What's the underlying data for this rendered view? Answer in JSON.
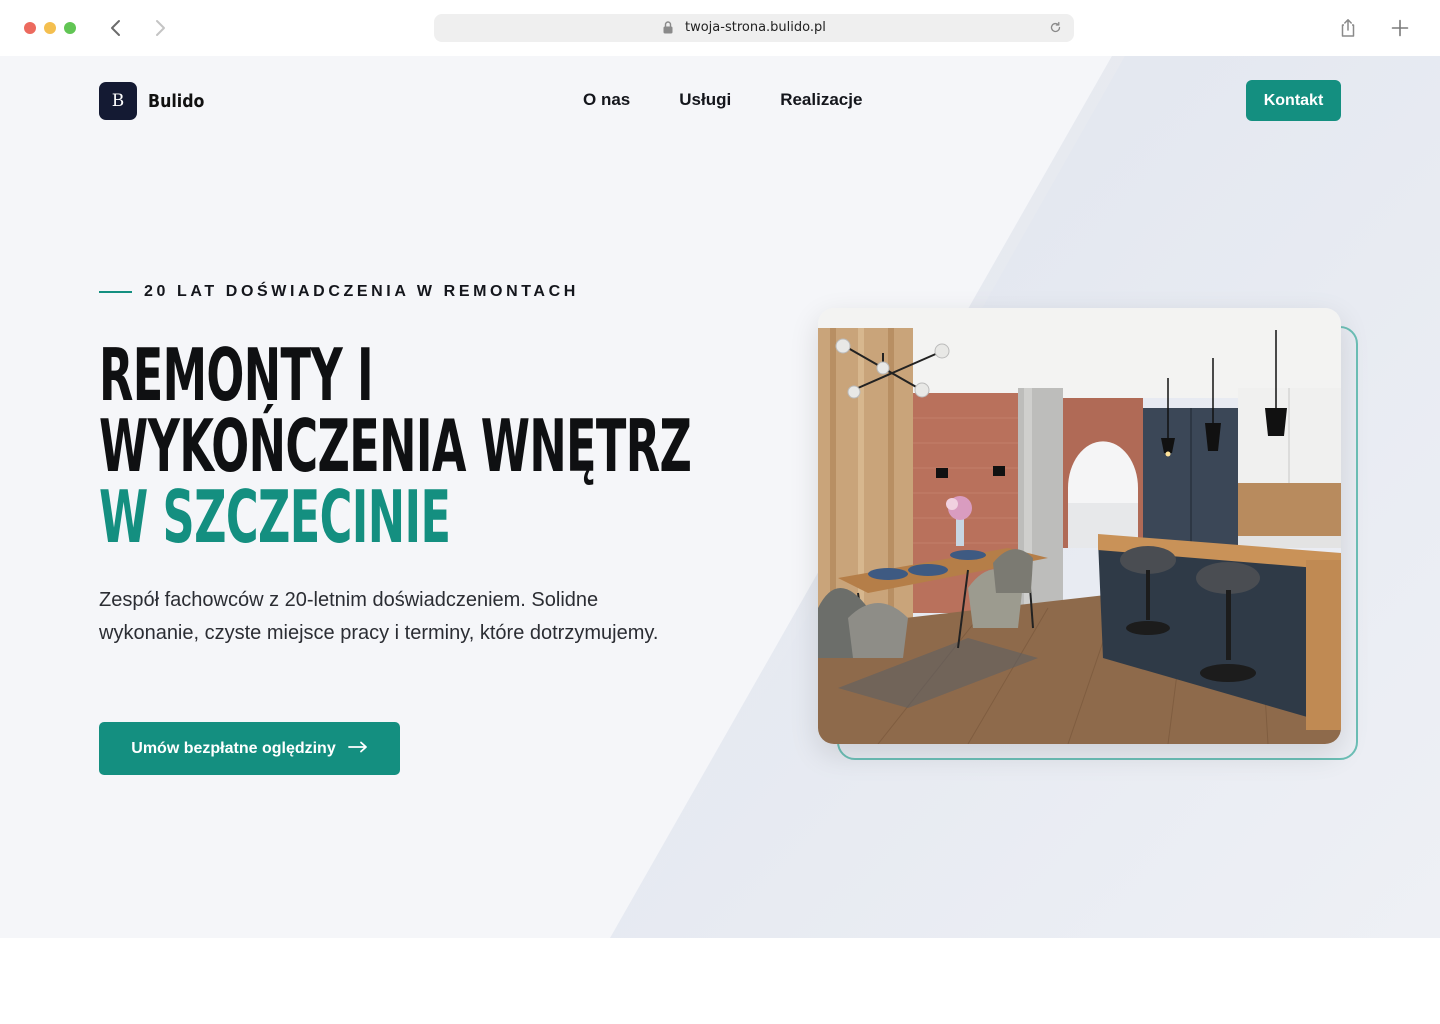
{
  "browser": {
    "url": "twoja-strona.bulido.pl"
  },
  "site": {
    "logo_letter": "B",
    "logo_name": "Bulido",
    "nav": [
      "O nas",
      "Usługi",
      "Realizacje"
    ],
    "contact_label": "Kontakt"
  },
  "hero": {
    "eyebrow": "20 LAT DOŚWIADCZENIA W REMONTACH",
    "headline_line1": "REMONTY I",
    "headline_line2": "WYKOŃCZENIA WNĘTRZ",
    "headline_accent": "W SZCZECINIE",
    "lead": "Zespół fachowców z 20-letnim doświadczeniem. Solidne wykonanie, czyste miejsce pracy i terminy, które dotrzymujemy.",
    "cta_label": "Umów bezpłatne oględziny",
    "cta_arrow": "⟶"
  },
  "colors": {
    "accent": "#148f80",
    "logo_bg": "#141a33",
    "page_bg": "#f5f6f9",
    "frame": "#6cbfb6"
  },
  "icons": {
    "back": "chevron-left-icon",
    "forward": "chevron-right-icon",
    "lock": "lock-icon",
    "reload": "reload-icon",
    "share": "share-icon",
    "new_tab": "plus-icon",
    "cta": "arrow-right-icon"
  }
}
